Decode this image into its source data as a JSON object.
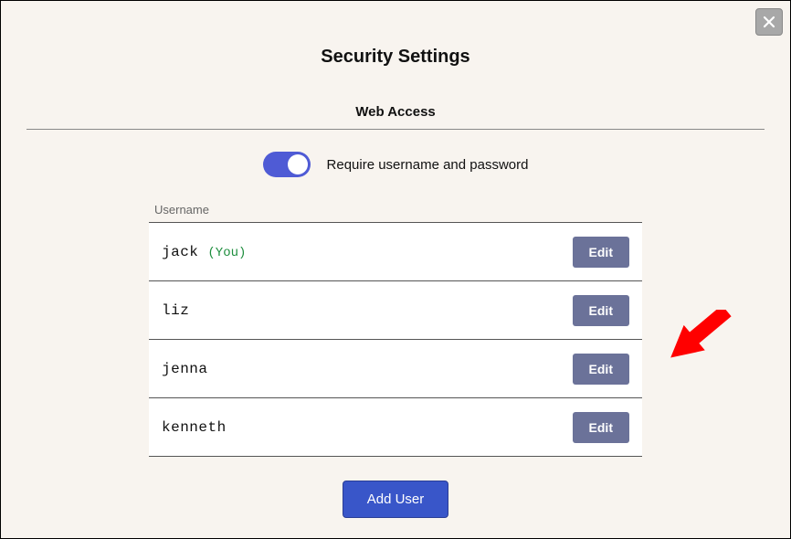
{
  "dialog": {
    "title": "Security Settings",
    "section": "Web Access",
    "toggle_label": "Require username and password",
    "toggle_on": true
  },
  "table": {
    "column_header": "Username",
    "rows": [
      {
        "username": "jack",
        "you_label": "(You)",
        "edit_label": "Edit"
      },
      {
        "username": "liz",
        "you_label": "",
        "edit_label": "Edit"
      },
      {
        "username": "jenna",
        "you_label": "",
        "edit_label": "Edit"
      },
      {
        "username": "kenneth",
        "you_label": "",
        "edit_label": "Edit"
      }
    ]
  },
  "buttons": {
    "add_user": "Add User"
  },
  "colors": {
    "accent": "#4f5bd5",
    "primary_button": "#3956c9",
    "secondary_button": "#6b7299",
    "you_text": "#1e8e3e",
    "arrow": "#ff0000"
  }
}
